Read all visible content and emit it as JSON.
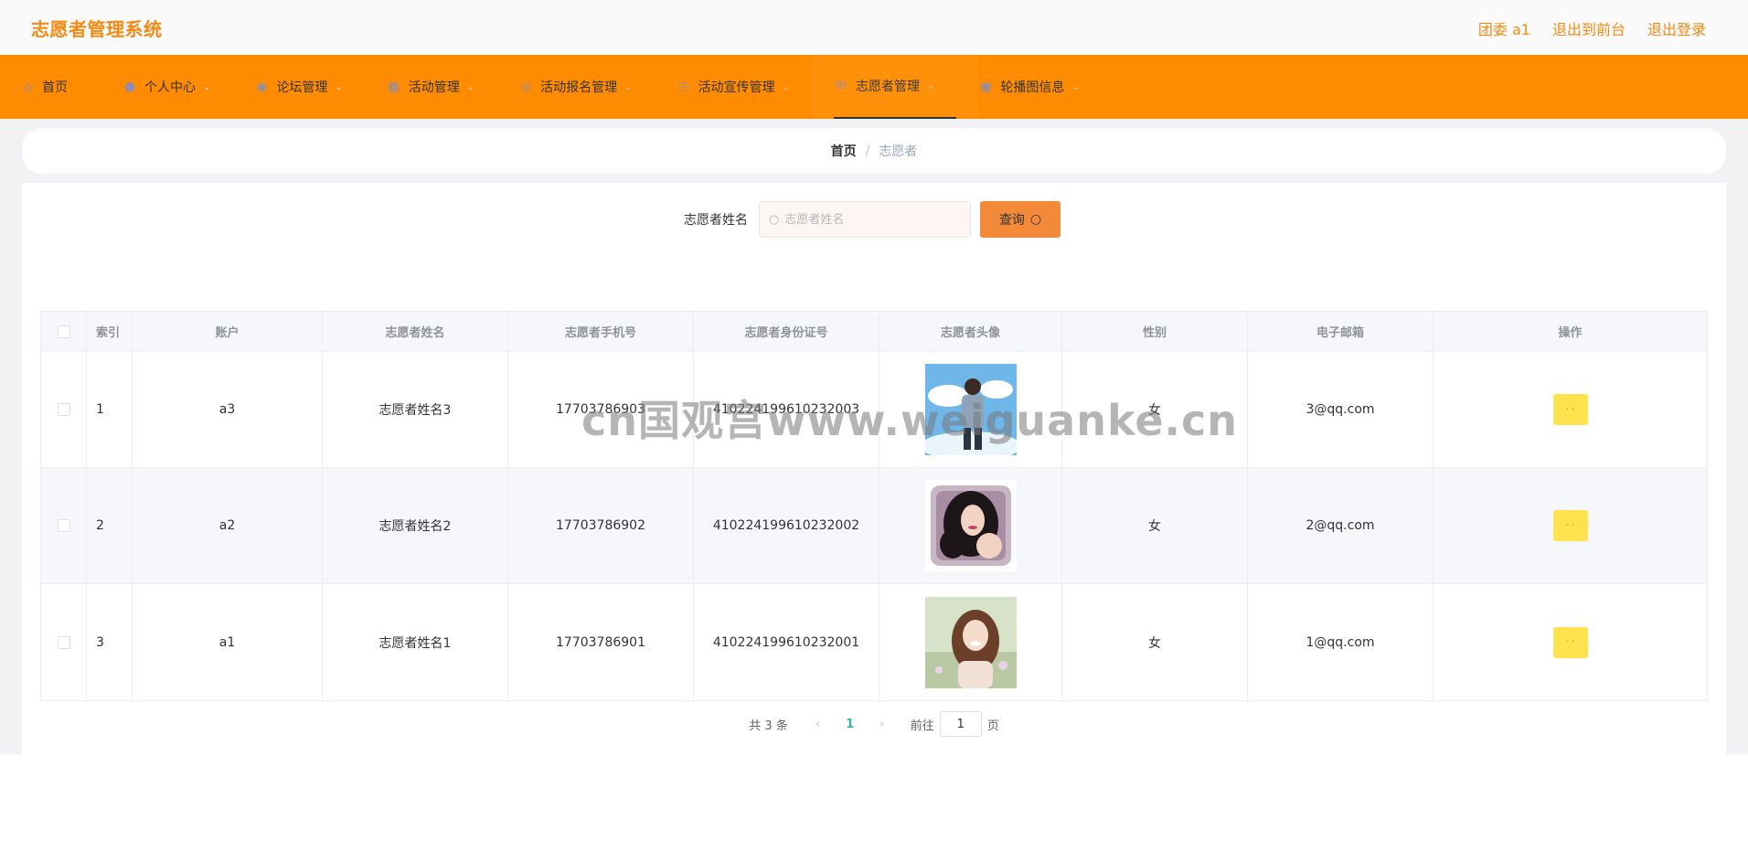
{
  "header": {
    "brand": "志愿者管理系统",
    "links": [
      "团委 a1",
      "退出到前台",
      "退出登录"
    ]
  },
  "nav": {
    "items": [
      {
        "label": "首页",
        "icon": "home-icon",
        "glyph": "⌂",
        "has_menu": false
      },
      {
        "label": "个人中心",
        "icon": "user-icon",
        "glyph": "●",
        "has_menu": true
      },
      {
        "label": "论坛管理",
        "icon": "location-icon",
        "glyph": "◉",
        "has_menu": true
      },
      {
        "label": "活动管理",
        "icon": "grid-icon",
        "glyph": "▦",
        "has_menu": true
      },
      {
        "label": "活动报名管理",
        "icon": "compass-icon",
        "glyph": "◎",
        "has_menu": true
      },
      {
        "label": "活动宣传管理",
        "icon": "clock-icon",
        "glyph": "◷",
        "has_menu": true
      },
      {
        "label": "志愿者管理",
        "icon": "mail-icon",
        "glyph": "✉",
        "has_menu": true,
        "active": true
      },
      {
        "label": "轮播图信息",
        "icon": "bag-icon",
        "glyph": "▣",
        "has_menu": true
      }
    ]
  },
  "breadcrumb": {
    "home": "首页",
    "separator": "/",
    "current": "志愿者"
  },
  "search": {
    "label": "志愿者姓名",
    "placeholder": "志愿者姓名",
    "value": "",
    "button": "查询"
  },
  "table": {
    "columns": [
      "索引",
      "账户",
      "志愿者姓名",
      "志愿者手机号",
      "志愿者身份证号",
      "志愿者头像",
      "性别",
      "电子邮箱",
      "操作"
    ],
    "rows": [
      {
        "index": "1",
        "account": "a3",
        "name": "志愿者姓名3",
        "phone": "17703786903",
        "id_card": "410224199610232003",
        "avatar": "avatar-sky-boy",
        "gender": "女",
        "email": "3@qq.com"
      },
      {
        "index": "2",
        "account": "a2",
        "name": "志愿者姓名2",
        "phone": "17703786902",
        "id_card": "410224199610232002",
        "avatar": "avatar-pillow-woman",
        "gender": "女",
        "email": "2@qq.com"
      },
      {
        "index": "3",
        "account": "a1",
        "name": "志愿者姓名1",
        "phone": "17703786901",
        "id_card": "410224199610232001",
        "avatar": "avatar-field-woman",
        "gender": "女",
        "email": "1@qq.com"
      }
    ],
    "action_label": "· ·"
  },
  "pagination": {
    "total": "共 3 条",
    "current_page": "1",
    "goto_label": "前往",
    "goto_value": "1",
    "page_suffix": "页"
  },
  "watermark": "cn国观宫www.weiguanke.cn",
  "colors": {
    "brand": "#f28a16",
    "navbar": "#ff8c00",
    "query_button": "#f28a3a",
    "action_button": "#ffe24d",
    "page_active": "#2fb5a8"
  }
}
